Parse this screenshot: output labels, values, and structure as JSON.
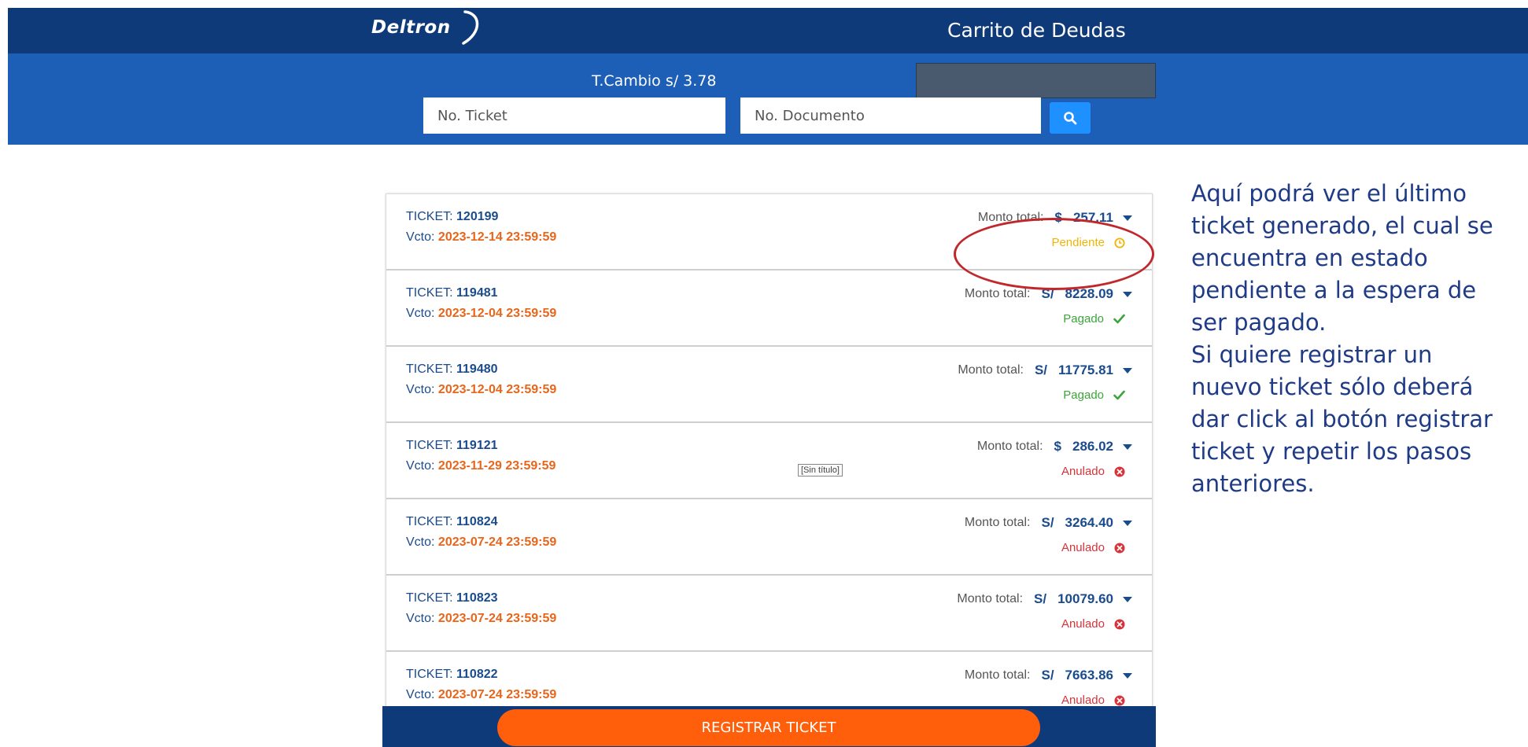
{
  "header": {
    "logo_text": "Deltron",
    "title": "Carrito de Deudas"
  },
  "search": {
    "exchange_rate": "T.Cambio s/ 3.78",
    "ticket_placeholder": "No. Ticket",
    "document_placeholder": "No. Documento",
    "search_icon": "search-icon"
  },
  "tickets": [
    {
      "label": "TICKET:",
      "number": "120199",
      "vcto_label": "Vcto:",
      "vcto": "2023-12-14 23:59:59",
      "amount_label": "Monto total:",
      "currency": "$",
      "amount": "257.11",
      "status": "Pendiente",
      "status_color": "#f0b400",
      "status_icon": "clock-icon"
    },
    {
      "label": "TICKET:",
      "number": "119481",
      "vcto_label": "Vcto:",
      "vcto": "2023-12-04 23:59:59",
      "amount_label": "Monto total:",
      "currency": "S/",
      "amount": "8228.09",
      "status": "Pagado",
      "status_color": "#3aa63a",
      "status_icon": "check-icon"
    },
    {
      "label": "TICKET:",
      "number": "119480",
      "vcto_label": "Vcto:",
      "vcto": "2023-12-04 23:59:59",
      "amount_label": "Monto total:",
      "currency": "S/",
      "amount": "11775.81",
      "status": "Pagado",
      "status_color": "#3aa63a",
      "status_icon": "check-icon"
    },
    {
      "label": "TICKET:",
      "number": "119121",
      "vcto_label": "Vcto:",
      "vcto": "2023-11-29 23:59:59",
      "amount_label": "Monto total:",
      "currency": "$",
      "amount": "286.02",
      "status": "Anulado",
      "status_color": "#d6333a",
      "status_icon": "x-circle-icon",
      "extra_tag": "[Sin título]"
    },
    {
      "label": "TICKET:",
      "number": "110824",
      "vcto_label": "Vcto:",
      "vcto": "2023-07-24 23:59:59",
      "amount_label": "Monto total:",
      "currency": "S/",
      "amount": "3264.40",
      "status": "Anulado",
      "status_color": "#d6333a",
      "status_icon": "x-circle-icon"
    },
    {
      "label": "TICKET:",
      "number": "110823",
      "vcto_label": "Vcto:",
      "vcto": "2023-07-24 23:59:59",
      "amount_label": "Monto total:",
      "currency": "S/",
      "amount": "10079.60",
      "status": "Anulado",
      "status_color": "#d6333a",
      "status_icon": "x-circle-icon"
    },
    {
      "label": "TICKET:",
      "number": "110822",
      "vcto_label": "Vcto:",
      "vcto": "2023-07-24 23:59:59",
      "amount_label": "Monto total:",
      "currency": "S/",
      "amount": "7663.86",
      "status": "Anulado",
      "status_color": "#d6333a",
      "status_icon": "x-circle-icon"
    }
  ],
  "footer": {
    "register_label": "REGISTRAR TICKET"
  },
  "annotation": {
    "lines": [
      "Aquí podrá ver el último",
      "ticket generado, el cual se",
      "encuentra en estado",
      "pendiente a la espera de",
      "ser pagado.",
      "Si quiere registrar un",
      "nuevo ticket sólo deberá",
      "dar click al botón registrar",
      "ticket y repetir los pasos",
      "anteriores."
    ]
  },
  "colors": {
    "header_dark": "#0f3a7a",
    "header_blue": "#1d5fb6",
    "accent_orange": "#ff5f0a",
    "date_orange": "#e8651a",
    "link_blue": "#1a4b8c",
    "highlight_red": "#c0282c"
  }
}
